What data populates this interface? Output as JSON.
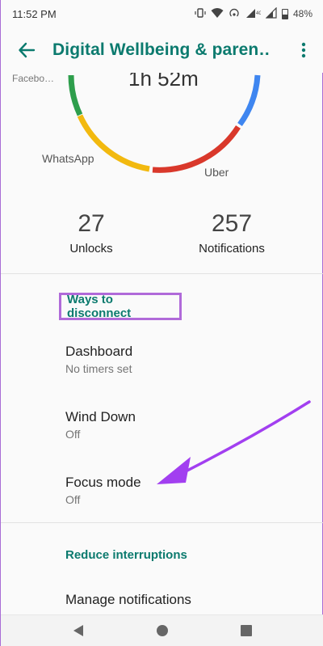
{
  "status_bar": {
    "time": "11:52 PM",
    "battery": "48%",
    "icons": [
      "vibrate-icon",
      "wifi-icon",
      "hotspot-icon",
      "signal-icon",
      "signal-icon",
      "battery-icon"
    ]
  },
  "app_bar": {
    "title": "Digital Wellbeing & paren…"
  },
  "usage_ring": {
    "labels": {
      "facebook": "Facebo…",
      "whatsapp": "WhatsApp",
      "uber": "Uber"
    },
    "time_partial": "1h 52m",
    "colors": {
      "green": "#2e9e4c",
      "yellow": "#f2b90f",
      "red": "#d9382b",
      "blue": "#3f86f0"
    }
  },
  "stats": {
    "unlocks_value": "27",
    "unlocks_label": "Unlocks",
    "notifications_value": "257",
    "notifications_label": "Notifications"
  },
  "sections": {
    "disconnect_header": "Ways to disconnect",
    "interruptions_header": "Reduce interruptions"
  },
  "items": [
    {
      "title": "Dashboard",
      "subtitle": "No timers set"
    },
    {
      "title": "Wind Down",
      "subtitle": "Off"
    },
    {
      "title": "Focus mode",
      "subtitle": "Off"
    },
    {
      "title": "Manage notifications",
      "subtitle": ""
    }
  ],
  "theme": {
    "accent": "#0b7a6e",
    "highlight": "#b06ad9"
  }
}
